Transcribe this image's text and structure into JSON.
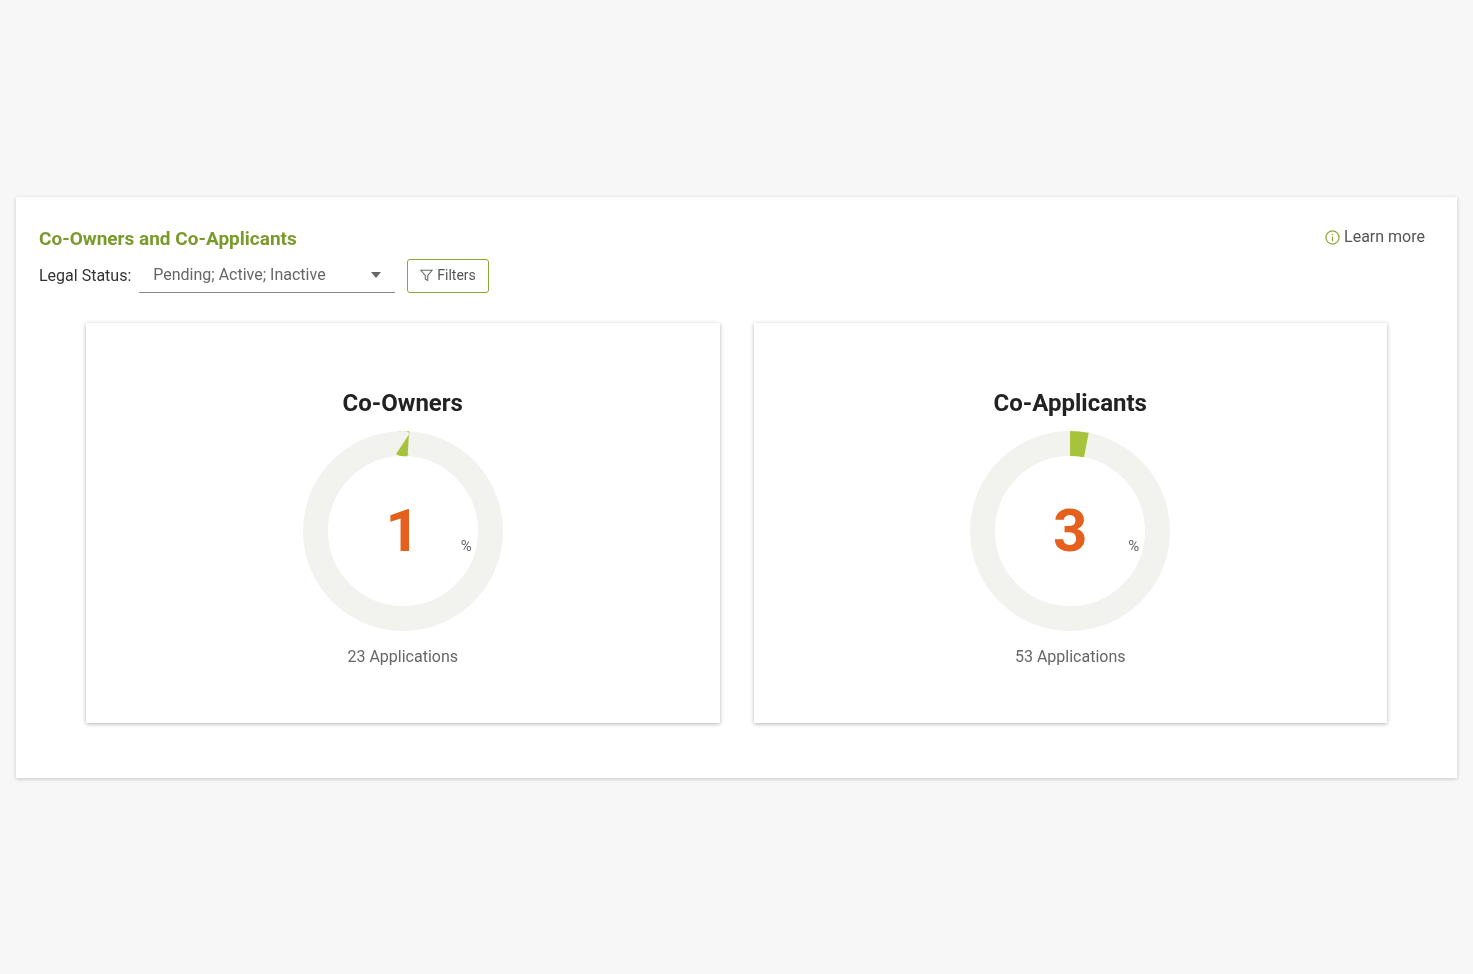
{
  "panel": {
    "title": "Co-Owners and Co-Applicants",
    "learn_more": "Learn more"
  },
  "filter": {
    "label": "Legal Status:",
    "value": "Pending; Active; Inactive",
    "button": "Filters"
  },
  "cards": [
    {
      "title": "Co-Owners",
      "value": "1",
      "unit": "%",
      "level": 0.01,
      "caption": "23 Applications"
    },
    {
      "title": "Co-Applicants",
      "value": "3",
      "unit": "%",
      "level": 0.03,
      "caption": "53 Applications"
    }
  ]
}
